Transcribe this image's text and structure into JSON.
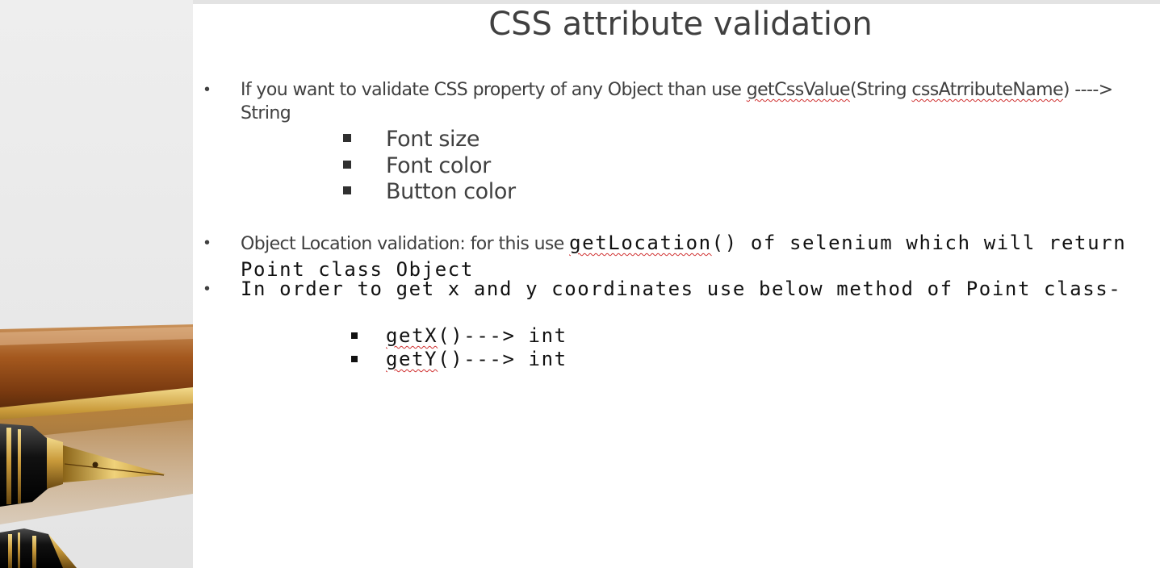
{
  "slide": {
    "title": "CSS attribute validation",
    "bullet1": {
      "pre": "If you want to validate CSS property of any Object than use ",
      "method": "getCssValue",
      "mid": "(String ",
      "param": "cssAtrributeName",
      "post": ") ----> String"
    },
    "sub_items_1": [
      "Font size",
      "Font color",
      "Button color"
    ],
    "bullet2": {
      "pre": "Object Location validation: for this use ",
      "method": "getLocation",
      "post": "() of selenium which will return Point class Object"
    },
    "bullet3": {
      "text": "In order to get x and y coordinates use below method of Point class-"
    },
    "sub_items_2": [
      {
        "method": "getX",
        "suffix": "()---> int"
      },
      {
        "method": "getY",
        "suffix": "()---> int"
      }
    ]
  },
  "colors": {
    "body_text": "#404040",
    "mono_text": "#111111",
    "spellcheck": "#d03030",
    "slide_bg": "#ffffff",
    "panel_bg": "#ececec"
  }
}
